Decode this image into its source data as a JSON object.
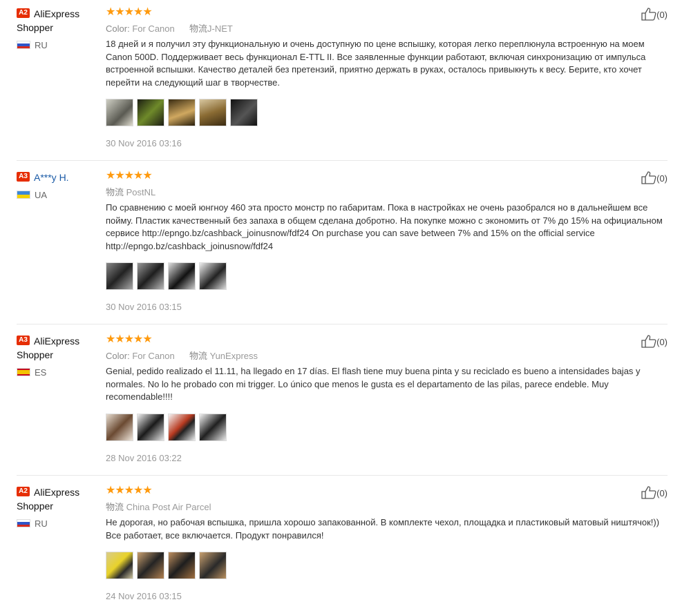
{
  "reviews": [
    {
      "level": "A2",
      "user": "AliExpress Shopper",
      "user_style": "plain",
      "country_code": "ru",
      "country": "RU",
      "rating": "★★★★★",
      "color_label": "Color:",
      "color_value": "For Canon",
      "logistics_label": "物流",
      "logistics": "J-NET",
      "text": "18 дней и я получил эту функциональную и очень доступную по цене вспышку, которая легко переплюнула встроенную на моем Canon 500D. Поддерживает весь функционал E-TTL II. Все заявленные функции работают, включая синхронизацию от импульса встроенной вспышки. Качество деталей без претензий, приятно держать в руках, осталось привыкнуть к весу. Берите, кто хочет перейти на следующий шаг в творчестве.",
      "photos": [
        {
          "name": "photo-1",
          "bg": "linear-gradient(135deg,#cfcfc4,#5a5a52 60%,#e0ddd0)"
        },
        {
          "name": "photo-2",
          "bg": "linear-gradient(135deg,#1b1d12,#6f8a2a 50%,#1d1d14)"
        },
        {
          "name": "photo-3",
          "bg": "linear-gradient(160deg,#3a2c12,#d0a860 55%,#2a1f0c)"
        },
        {
          "name": "photo-4",
          "bg": "linear-gradient(160deg,#d8c7a0,#8a6b33 50%,#3b2b12)"
        },
        {
          "name": "photo-5",
          "bg": "linear-gradient(135deg,#111,#555 55%,#111)"
        }
      ],
      "date": "30 Nov 2016 03:16",
      "helpful": "(0)"
    },
    {
      "level": "A3",
      "user": "A***y H.",
      "user_style": "link",
      "country_code": "ua",
      "country": "UA",
      "rating": "★★★★★",
      "color_label": "",
      "color_value": "",
      "logistics_label": "物流",
      "logistics": "PostNL",
      "text": "По сравнению с моей юнгноу 460 эта просто монстр по габаритам. Пока в настройках не очень разобрался но в дальнейшем все пойму. Пластик качественный без запаха в общем сделана добротно. На покупке можно с экономить от 7% до 15% на официальном сервисе http://epngo.bz/cashback_joinusnow/fdf24 On purchase you can save between 7% and 15% on the official service http://epngo.bz/cashback_joinusnow/fdf24",
      "photos": [
        {
          "name": "photo-1",
          "bg": "linear-gradient(135deg,#888,#222 50%,#aaa)"
        },
        {
          "name": "photo-2",
          "bg": "linear-gradient(135deg,#999,#1e1e1e 50%,#bbb)"
        },
        {
          "name": "photo-3",
          "bg": "linear-gradient(135deg,#ddd,#111 55%,#ccc)"
        },
        {
          "name": "photo-4",
          "bg": "linear-gradient(135deg,#eee,#222 55%,#ddd)"
        }
      ],
      "date": "30 Nov 2016 03:15",
      "helpful": "(0)"
    },
    {
      "level": "A3",
      "user": "AliExpress Shopper",
      "user_style": "plain",
      "country_code": "es",
      "country": "ES",
      "rating": "★★★★★",
      "color_label": "Color:",
      "color_value": "For Canon",
      "logistics_label": "物流",
      "logistics": "YunExpress",
      "text": "Genial, pedido realizado el 11.11, ha llegado en 17 días. El flash tiene muy buena pinta y su reciclado es bueno a intensidades bajas y normales. No lo he probado con mi trigger. Lo único que menos le gusta es el departamento de las pilas, parece endeble. Muy recomendable!!!!",
      "photos": [
        {
          "name": "photo-1",
          "bg": "linear-gradient(135deg,#e6dcd0,#6b4a32 50%,#efe6dc)"
        },
        {
          "name": "photo-2",
          "bg": "linear-gradient(135deg,#f0f0f0,#1a1a1a 50%,#e8e8e8)"
        },
        {
          "name": "photo-3",
          "bg": "linear-gradient(135deg,#f5f5f5,#b83a20 45%,#222 60%,#eee)"
        },
        {
          "name": "photo-4",
          "bg": "linear-gradient(135deg,#f2f2f2,#202020 50%,#e9e9e9)"
        }
      ],
      "date": "28 Nov 2016 03:22",
      "helpful": "(0)"
    },
    {
      "level": "A2",
      "user": "AliExpress Shopper",
      "user_style": "plain",
      "country_code": "ru",
      "country": "RU",
      "rating": "★★★★★",
      "color_label": "",
      "color_value": "",
      "logistics_label": "物流",
      "logistics": "China Post Air Parcel",
      "text": "Не дорогая, но рабочая вспышка, пришла хорошо запакованной. В комплекте чехол, площадка и пластиковый матовый ништячок!)) Все работает, все включается. Продукт понравился!",
      "photos": [
        {
          "name": "photo-1",
          "bg": "linear-gradient(135deg,#d9cc8a,#e8d22a 45%,#2a2a2a 70%,#cfc6a0)"
        },
        {
          "name": "photo-2",
          "bg": "linear-gradient(135deg,#caa070,#242424 50%,#b08050)"
        },
        {
          "name": "photo-3",
          "bg": "linear-gradient(135deg,#c09060,#1e1e1e 50%,#a07040)"
        },
        {
          "name": "photo-4",
          "bg": "linear-gradient(135deg,#c8a070,#2a2a2a 55%,#b89060)"
        }
      ],
      "date": "24 Nov 2016 03:15",
      "helpful": "(0)"
    }
  ]
}
